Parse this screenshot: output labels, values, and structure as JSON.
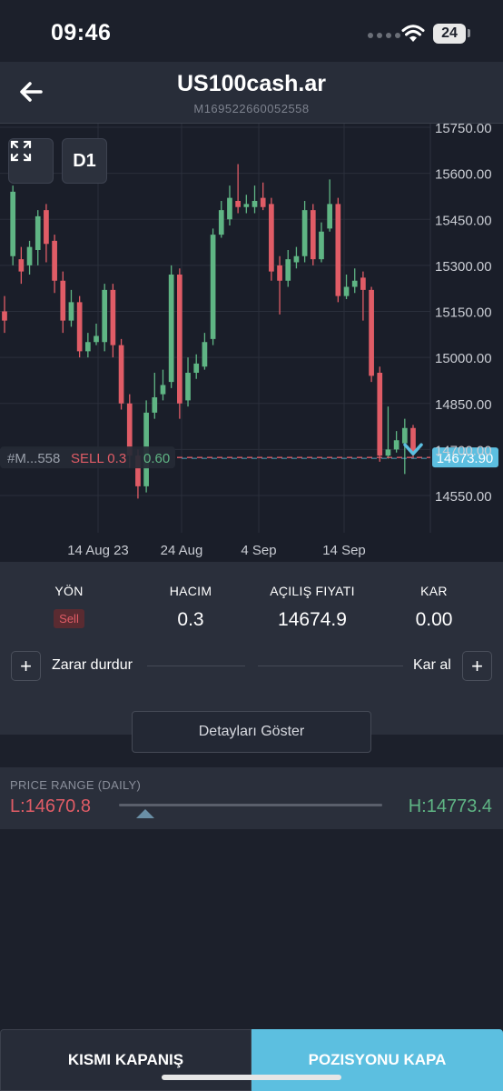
{
  "status": {
    "time": "09:46",
    "battery": "24"
  },
  "header": {
    "title": "US100cash.ar",
    "subtitle": "M169522660052558"
  },
  "chart": {
    "period": "D1",
    "position_label": "#M...558",
    "side_label": "SELL 0.3",
    "profit_label": "0.60",
    "current_price": "14673.90",
    "colors": {
      "up": "#5fb584",
      "down": "#e05c66",
      "price": "#5cbfe0"
    },
    "y_labels": [
      "15750.00",
      "15600.00",
      "15450.00",
      "15300.00",
      "15150.00",
      "15000.00",
      "14850.00",
      "14700.00",
      "14550.00"
    ],
    "x_labels": [
      "14 Aug 23",
      "24 Aug",
      "4 Sep",
      "14 Sep"
    ]
  },
  "chart_data": {
    "type": "candlestick",
    "y_ticks": [
      15750,
      15600,
      15450,
      15300,
      15150,
      15000,
      14850,
      14700,
      14550
    ],
    "x_ticks": [
      "14 Aug 23",
      "24 Aug",
      "4 Sep",
      "14 Sep"
    ],
    "current_price": 14673.9,
    "candles": [
      {
        "o": 15150,
        "c": 15120,
        "h": 15200,
        "l": 15080
      },
      {
        "o": 15330,
        "c": 15540,
        "h": 15560,
        "l": 15300
      },
      {
        "o": 15320,
        "c": 15280,
        "h": 15360,
        "l": 15240
      },
      {
        "o": 15300,
        "c": 15360,
        "h": 15380,
        "l": 15270
      },
      {
        "o": 15350,
        "c": 15460,
        "h": 15480,
        "l": 15300
      },
      {
        "o": 15480,
        "c": 15370,
        "h": 15500,
        "l": 15310
      },
      {
        "o": 15380,
        "c": 15250,
        "h": 15400,
        "l": 15210
      },
      {
        "o": 15250,
        "c": 15120,
        "h": 15280,
        "l": 15080
      },
      {
        "o": 15120,
        "c": 15180,
        "h": 15220,
        "l": 15100
      },
      {
        "o": 15180,
        "c": 15020,
        "h": 15200,
        "l": 15000
      },
      {
        "o": 15020,
        "c": 15050,
        "h": 15080,
        "l": 15000
      },
      {
        "o": 15050,
        "c": 15070,
        "h": 15110,
        "l": 15040
      },
      {
        "o": 15050,
        "c": 15220,
        "h": 15240,
        "l": 15020
      },
      {
        "o": 15220,
        "c": 15040,
        "h": 15240,
        "l": 15000
      },
      {
        "o": 15040,
        "c": 14850,
        "h": 15060,
        "l": 14830
      },
      {
        "o": 14850,
        "c": 14680,
        "h": 14880,
        "l": 14640
      },
      {
        "o": 14680,
        "c": 14580,
        "h": 14700,
        "l": 14540
      },
      {
        "o": 14580,
        "c": 14820,
        "h": 14860,
        "l": 14560
      },
      {
        "o": 14820,
        "c": 14870,
        "h": 14950,
        "l": 14800
      },
      {
        "o": 14880,
        "c": 14910,
        "h": 14960,
        "l": 14860
      },
      {
        "o": 14920,
        "c": 15270,
        "h": 15300,
        "l": 14900
      },
      {
        "o": 15270,
        "c": 14850,
        "h": 15290,
        "l": 14800
      },
      {
        "o": 14860,
        "c": 14950,
        "h": 15000,
        "l": 14840
      },
      {
        "o": 14950,
        "c": 14980,
        "h": 15010,
        "l": 14930
      },
      {
        "o": 14970,
        "c": 15050,
        "h": 15080,
        "l": 14960
      },
      {
        "o": 15060,
        "c": 15400,
        "h": 15420,
        "l": 15040
      },
      {
        "o": 15400,
        "c": 15480,
        "h": 15510,
        "l": 15390
      },
      {
        "o": 15450,
        "c": 15520,
        "h": 15560,
        "l": 15430
      },
      {
        "o": 15510,
        "c": 15490,
        "h": 15630,
        "l": 15470
      },
      {
        "o": 15490,
        "c": 15500,
        "h": 15530,
        "l": 15470
      },
      {
        "o": 15490,
        "c": 15510,
        "h": 15560,
        "l": 15470
      },
      {
        "o": 15520,
        "c": 15490,
        "h": 15570,
        "l": 15480
      },
      {
        "o": 15500,
        "c": 15280,
        "h": 15520,
        "l": 15250
      },
      {
        "o": 15300,
        "c": 15250,
        "h": 15330,
        "l": 15140
      },
      {
        "o": 15250,
        "c": 15320,
        "h": 15350,
        "l": 15230
      },
      {
        "o": 15310,
        "c": 15330,
        "h": 15360,
        "l": 15290
      },
      {
        "o": 15330,
        "c": 15480,
        "h": 15510,
        "l": 15310
      },
      {
        "o": 15480,
        "c": 15320,
        "h": 15500,
        "l": 15300
      },
      {
        "o": 15320,
        "c": 15410,
        "h": 15440,
        "l": 15310
      },
      {
        "o": 15420,
        "c": 15500,
        "h": 15580,
        "l": 15410
      },
      {
        "o": 15500,
        "c": 15200,
        "h": 15520,
        "l": 15180
      },
      {
        "o": 15200,
        "c": 15230,
        "h": 15270,
        "l": 15190
      },
      {
        "o": 15230,
        "c": 15250,
        "h": 15290,
        "l": 15210
      },
      {
        "o": 15260,
        "c": 15220,
        "h": 15280,
        "l": 15120
      },
      {
        "o": 15220,
        "c": 14940,
        "h": 15230,
        "l": 14920
      },
      {
        "o": 14950,
        "c": 14680,
        "h": 14970,
        "l": 14660
      },
      {
        "o": 14680,
        "c": 14700,
        "h": 14840,
        "l": 14670
      },
      {
        "o": 14700,
        "c": 14730,
        "h": 14760,
        "l": 14690
      },
      {
        "o": 14720,
        "c": 14770,
        "h": 14800,
        "l": 14620
      },
      {
        "o": 14770,
        "c": 14690,
        "h": 14780,
        "l": 14670
      }
    ]
  },
  "position": {
    "cols": [
      {
        "label": "YÖN",
        "value": "Sell"
      },
      {
        "label": "HACIM",
        "value": "0.3"
      },
      {
        "label": "AÇILIŞ FIYATI",
        "value": "14674.9"
      },
      {
        "label": "KAR",
        "value": "0.00"
      }
    ],
    "stop_loss_label": "Zarar durdur",
    "take_profit_label": "Kar al",
    "plus": "+"
  },
  "details_button": "Detayları Göster",
  "price_range": {
    "title": "PRICE RANGE (DAILY)",
    "low": "L:14670.8",
    "high": "H:14773.4",
    "low_value": 14670.8,
    "high_value": 14773.4,
    "current_value": 14673.9
  },
  "bottom": {
    "partial_close": "KISMI KAPANIŞ",
    "close_position": "POZISYONU KAPA"
  }
}
